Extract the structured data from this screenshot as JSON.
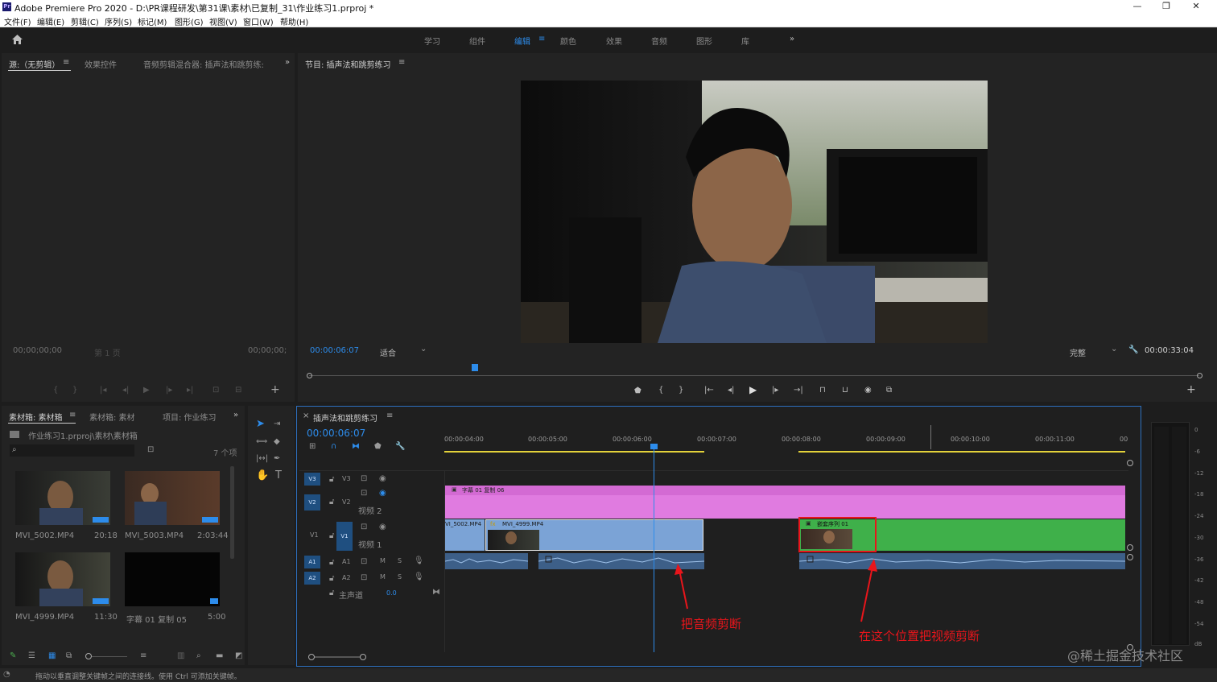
{
  "app": {
    "title": "Adobe Premiere Pro 2020 - D:\\PR课程研发\\第31课\\素材\\已复制_31\\作业练习1.prproj *",
    "logo": "Pr",
    "win_min": "—",
    "win_restore": "❐",
    "win_close": "✕"
  },
  "menu": [
    "文件(F)",
    "编辑(E)",
    "剪辑(C)",
    "序列(S)",
    "标记(M)",
    "图形(G)",
    "视图(V)",
    "窗口(W)",
    "帮助(H)"
  ],
  "workspaces": [
    "学习",
    "组件",
    "编辑",
    "颜色",
    "效果",
    "音频",
    "图形",
    "库"
  ],
  "workspace_more": "»",
  "source_panel": {
    "tabs": [
      "源:（无剪辑）",
      "效果控件",
      "音频剪辑混合器: 插声法和跳剪练:"
    ],
    "menu_icon": "≡",
    "more": "»",
    "timecode_left": "00;00;00;00",
    "timecode_right": "00;00;00;",
    "page_label": "第 1 页"
  },
  "program_panel": {
    "title": "节目: 插声法和跳剪练习",
    "menu_icon": "≡",
    "timecode": "00:00:06:07",
    "fit_label": "适合",
    "quality_label": "完整",
    "duration": "00:00:33:04"
  },
  "project_panel": {
    "tabs": [
      "素材箱: 素材箱",
      "素材箱: 素材",
      "项目: 作业练习"
    ],
    "menu_icon": "≡",
    "more": "»",
    "path": "作业练习1.prproj\\素材\\素材箱",
    "count": "7 个项",
    "items": [
      {
        "name": "MVI_5002.MP4",
        "duration": "20:18"
      },
      {
        "name": "MVI_5003.MP4",
        "duration": "2:03:44"
      },
      {
        "name": "MVI_4999.MP4",
        "duration": "11:30"
      },
      {
        "name": "字幕 01 复制 05",
        "duration": "5:00"
      }
    ]
  },
  "timeline": {
    "sequence_name": "插声法和跳剪练习",
    "menu_icon": "≡",
    "close": "×",
    "timecode": "00:00:06:07",
    "ruler": [
      "00:00:04:00",
      "00:00:05:00",
      "00:00:06:00",
      "00:00:07:00",
      "00:00:08:00",
      "00:00:09:00",
      "00:00:10:00",
      "00:00:11:00",
      "00"
    ],
    "tracks": {
      "v3": "V3",
      "v2": "V2",
      "v1": "V1",
      "a1": "A1",
      "a2": "A2",
      "v2_name": "视频 2",
      "v1_name": "视频 1",
      "mute": "M",
      "solo": "S",
      "master_label": "主声道",
      "master_value": "0.0"
    },
    "clips": {
      "title_clip": "字幕 01 复制 06",
      "v1_clip_a": "VI_5002.MP4",
      "v1_clip_b": "MVI_4999.MP4",
      "v1_clip_c": "嵌套序列 01"
    }
  },
  "annotations": {
    "audio_cut": "把音频剪断",
    "video_cut": "在这个位置把视频剪断"
  },
  "meter_labels": [
    "0",
    "-6",
    "-12",
    "-18",
    "-24",
    "-30",
    "-36",
    "-42",
    "-48",
    "-54",
    "dB"
  ],
  "status_bar": "拖动以垂直调整关键帧之间的连接线。使用 Ctrl 可添加关键帧。",
  "watermark": "@稀土掘金技术社区",
  "colors": {
    "accent": "#2d8ceb",
    "title_clip": "#e07be0",
    "video_clip_blue": "#7ba3d6",
    "nested_clip_green": "#3fb04a",
    "audio_clip": "#3d5f88",
    "annotation_red": "#e8151b",
    "in_out_bar": "#e3d23a"
  }
}
